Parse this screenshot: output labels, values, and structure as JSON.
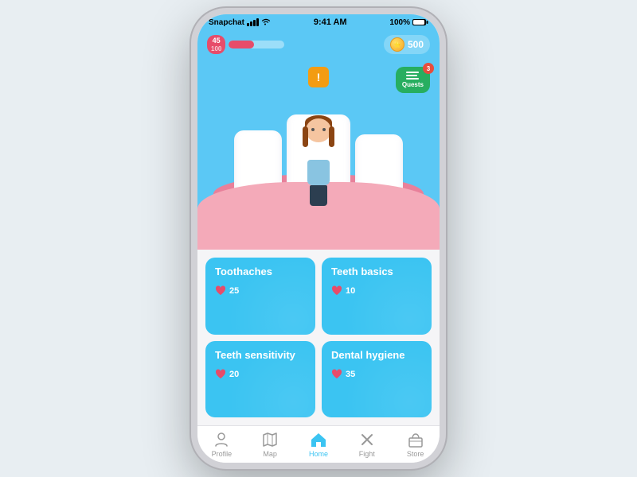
{
  "statusBar": {
    "carrier": "Snapchat",
    "time": "9:41 AM",
    "battery": "100%"
  },
  "gameHeader": {
    "hp": {
      "current": "45",
      "max": "100",
      "fillPercent": 45
    },
    "coins": "500"
  },
  "questButton": {
    "label": "Quests",
    "badge": "3"
  },
  "warning": {
    "symbol": "!"
  },
  "categories": [
    {
      "title": "Toothaches",
      "likes": 25
    },
    {
      "title": "Teeth basics",
      "likes": 10
    },
    {
      "title": "Teeth sensitivity",
      "likes": 20
    },
    {
      "title": "Dental hygiene",
      "likes": 35
    }
  ],
  "bottomNav": [
    {
      "label": "Profile",
      "icon": "profile-icon",
      "active": false
    },
    {
      "label": "Map",
      "icon": "map-icon",
      "active": false
    },
    {
      "label": "Home",
      "icon": "home-icon",
      "active": true
    },
    {
      "label": "Fight",
      "icon": "fight-icon",
      "active": false
    },
    {
      "label": "Store",
      "icon": "store-icon",
      "active": false
    }
  ]
}
